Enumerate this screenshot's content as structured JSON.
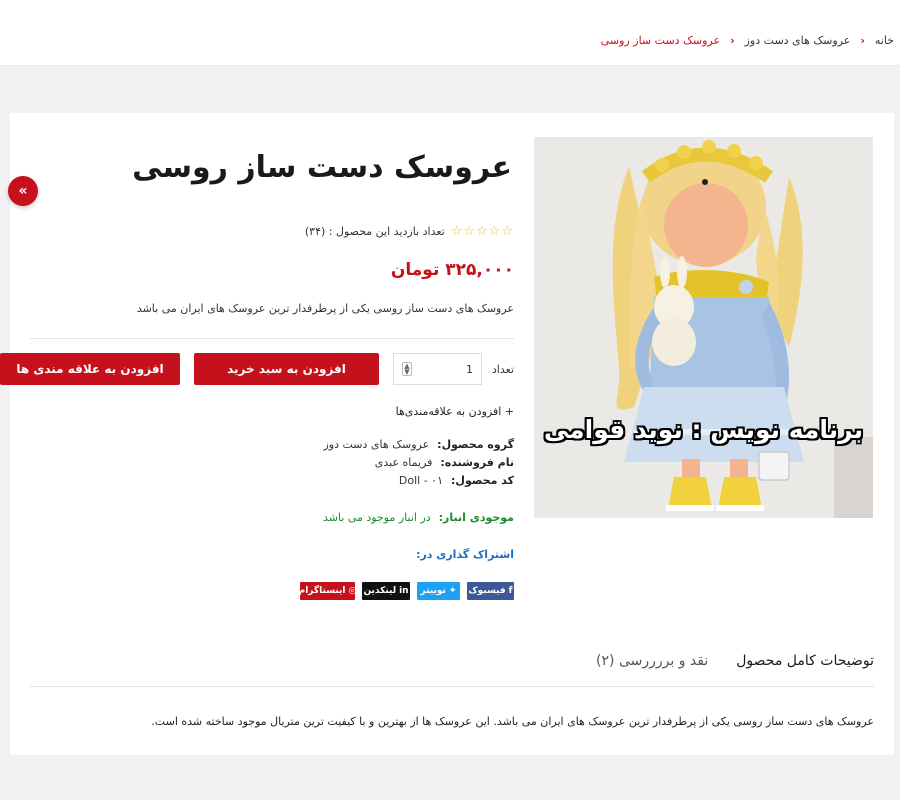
{
  "breadcrumb": {
    "home": "خانه",
    "category": "عروسک های دست دوز",
    "current": "عروسک دست ساز روسی"
  },
  "product": {
    "title": "عروسک دست ساز روسی",
    "stars": "☆☆☆☆☆",
    "rating_percent": 0,
    "views_label": "تعداد بازدید این محصول : (۳۴)",
    "price": "۳۲۵,۰۰۰ تومان",
    "short_description": "عروسک های دست ساز روسی یکی از پرطرفدار ترین عروسک های ایران می باشد",
    "watermark": "برنامه نویس : نوید قوامی"
  },
  "purchase": {
    "qty_label": "تعداد",
    "qty_value": "1",
    "add_to_cart": "افزودن به سبد خرید",
    "add_to_wishlist": "افزودن به علاقه مندی ها",
    "add_wishlist_link": "+ افزودن به علاقه‌مندی‌ها"
  },
  "meta": {
    "group_label": "گروه محصول:",
    "group_value": "عروسک های دست دوز",
    "seller_label": "نام فروشنده:",
    "seller_value": "فریماه عبدی",
    "code_label": "کد محصول:",
    "code_value": "Doll - ۰۱",
    "stock_label": "موجودی انبار:",
    "stock_value": "در انبار موجود می باشد"
  },
  "share": {
    "label": "اشتراک گذاری در:",
    "facebook": "فیسبوک",
    "twitter": "توییتر",
    "linkedin": "لینکدین",
    "instagram": "اینستاگرام"
  },
  "tabs": {
    "description": "توضیحات کامل محصول",
    "reviews": "نقد و بررررسی (۲)"
  },
  "full_description": "عروسک های دست ساز روسی یکی از پرطرفدار ترین عروسک های ایران می باشد. این عروسک ها از بهترین و با کیفیت ترین متریال موجود ساخته شده است.",
  "colors": {
    "accent": "#c4111b",
    "stock": "#1c8a2c",
    "share": "#1b6fc2",
    "facebook": "#3b5998",
    "twitter": "#1da1f2",
    "linkedin": "#111111",
    "instagram": "#c4111b"
  },
  "icons": {
    "scroll_top": "double-chevron-up-icon",
    "breadcrumb_sep": "chevron-left-icon"
  }
}
